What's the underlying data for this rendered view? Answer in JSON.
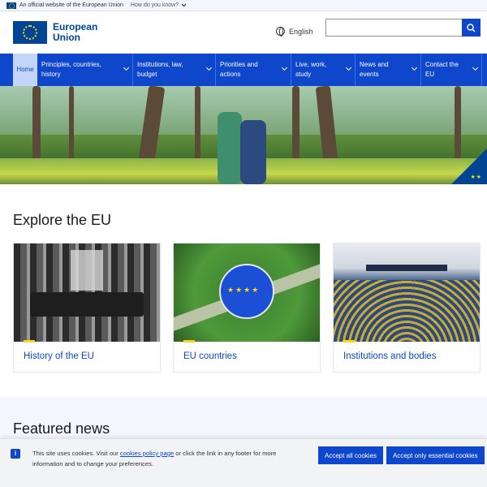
{
  "topbar": {
    "official_text": "An official website of the European Union",
    "how_text": "How do you know?"
  },
  "header": {
    "logo_line1": "European",
    "logo_line2": "Union",
    "language": "English",
    "search_placeholder": ""
  },
  "nav": {
    "items": [
      {
        "label": "Home"
      },
      {
        "label": "Principles, countries, history"
      },
      {
        "label": "Institutions, law, budget"
      },
      {
        "label": "Priorities and actions"
      },
      {
        "label": "Live, work, study"
      },
      {
        "label": "News and events"
      },
      {
        "label": "Contact the EU"
      }
    ]
  },
  "explore": {
    "title": "Explore the EU",
    "cards": [
      {
        "title": "History of the EU"
      },
      {
        "title": "EU countries"
      },
      {
        "title": "Institutions and bodies"
      }
    ]
  },
  "news": {
    "title": "Featured news"
  },
  "cookie": {
    "text_before": "This site uses cookies. Visit our ",
    "link": "cookies policy page",
    "text_after": " or click the link in any footer for more information and to change your preferences.",
    "accept_all": "Accept all cookies",
    "accept_essential": "Accept only essential cookies"
  },
  "colors": {
    "primary": "#0e47cb",
    "eu_blue": "#004494",
    "eu_yellow": "#ffd617"
  }
}
